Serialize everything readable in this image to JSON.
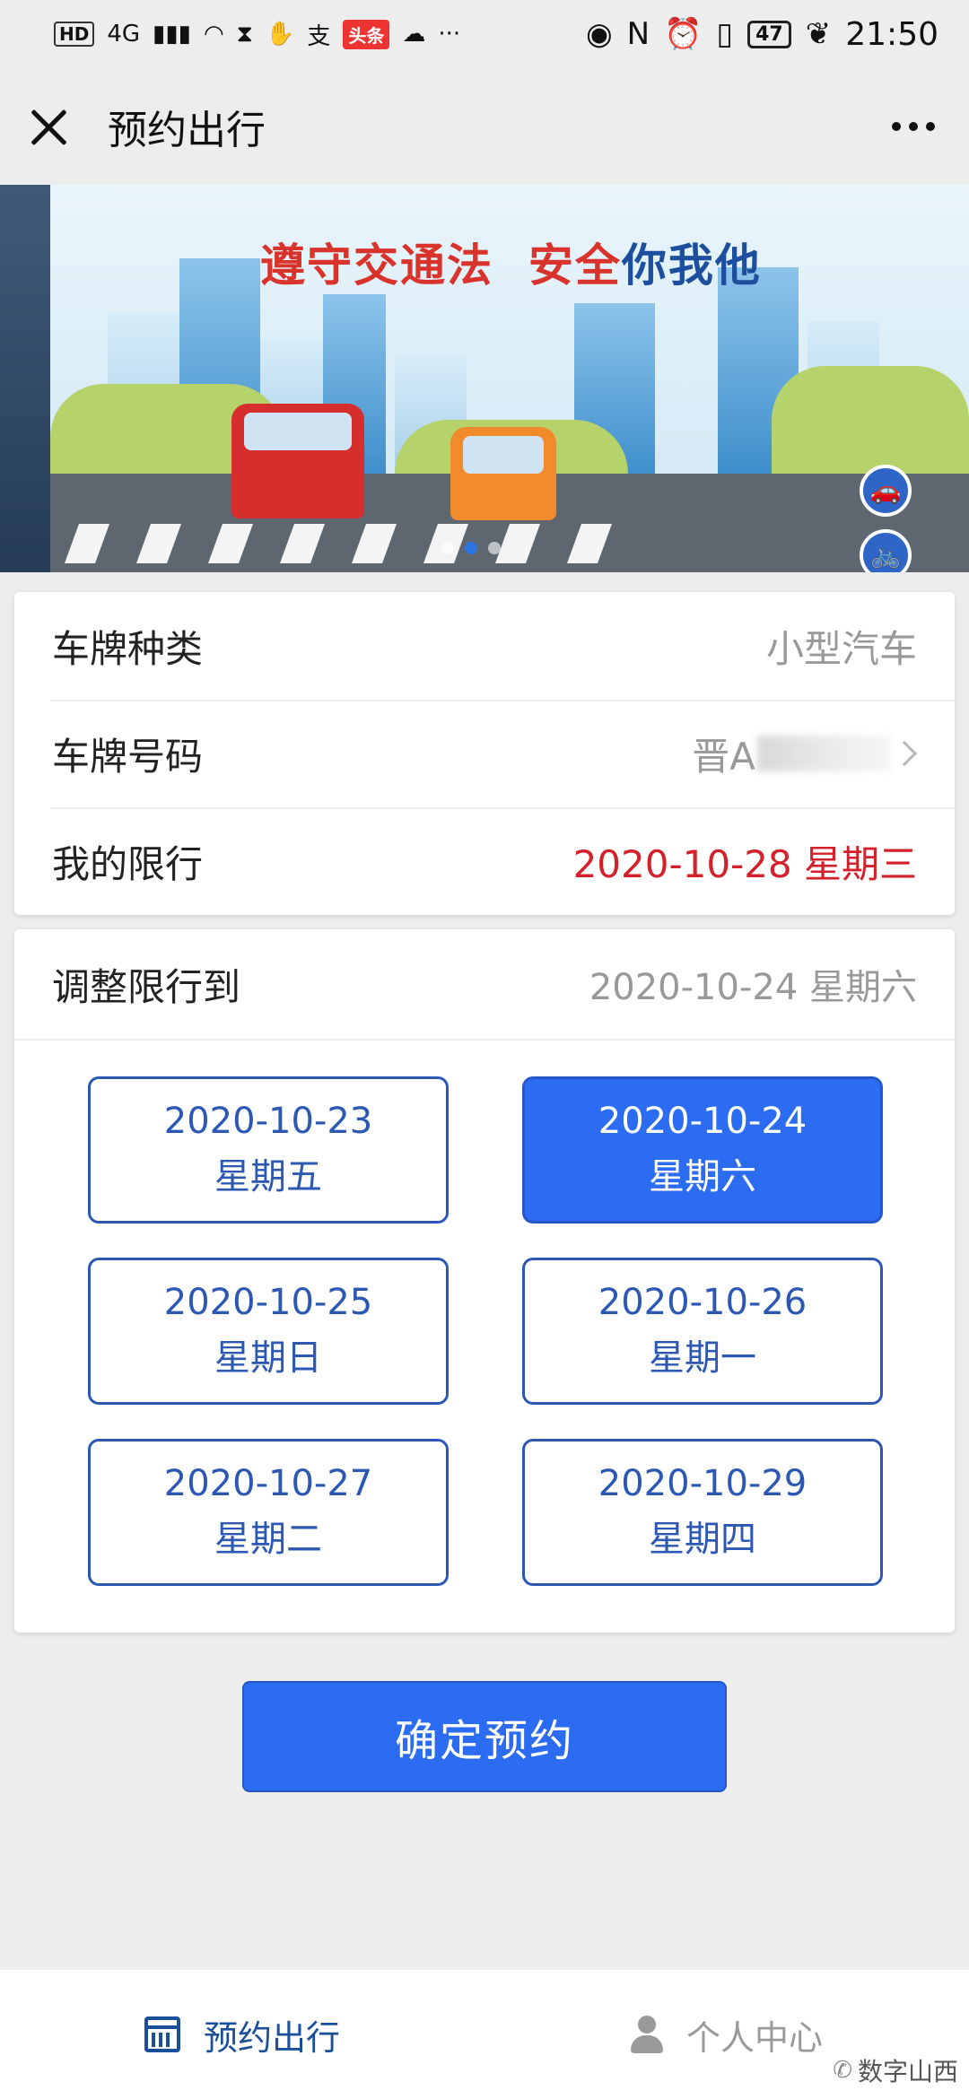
{
  "status_bar": {
    "left_indicators": [
      "HD",
      "4G",
      "头条"
    ],
    "battery": "47",
    "time": "21:50"
  },
  "nav": {
    "title": "预约出行"
  },
  "banner": {
    "title_part1": "遵守交通法",
    "title_part2": "安全你我他",
    "pages": 3,
    "active_page": 2
  },
  "vehicle_info": {
    "plate_type_label": "车牌种类",
    "plate_type_value": "小型汽车",
    "plate_number_label": "车牌号码",
    "plate_number_prefix": "晋A",
    "my_restriction_label": "我的限行",
    "my_restriction_value": "2020-10-28 星期三"
  },
  "adjust": {
    "label": "调整限行到",
    "value": "2020-10-24 星期六",
    "options": [
      {
        "date": "2020-10-23",
        "weekday": "星期五",
        "selected": false
      },
      {
        "date": "2020-10-24",
        "weekday": "星期六",
        "selected": true
      },
      {
        "date": "2020-10-25",
        "weekday": "星期日",
        "selected": false
      },
      {
        "date": "2020-10-26",
        "weekday": "星期一",
        "selected": false
      },
      {
        "date": "2020-10-27",
        "weekday": "星期二",
        "selected": false
      },
      {
        "date": "2020-10-29",
        "weekday": "星期四",
        "selected": false
      }
    ]
  },
  "confirm_button": "确定预约",
  "tabbar": {
    "tab1": "预约出行",
    "tab2": "个人中心"
  },
  "watermark": "数字山西",
  "colors": {
    "primary": "#2c6cf2",
    "outline": "#2c58b4",
    "warning": "#d3202a"
  }
}
